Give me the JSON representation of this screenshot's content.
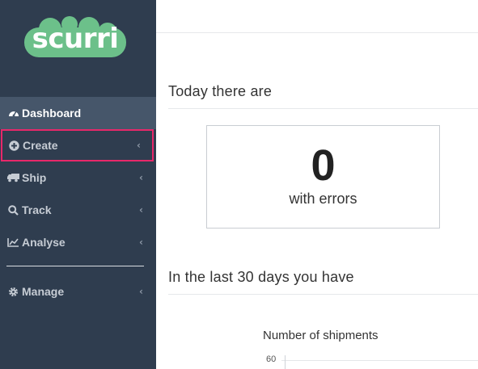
{
  "brand": {
    "name": "scurri",
    "cloud_color": "#6cc08a"
  },
  "sidebar": {
    "items": [
      {
        "label": "Dashboard",
        "icon": "dashboard-icon"
      },
      {
        "label": "Create",
        "icon": "plus-circle-icon"
      },
      {
        "label": "Ship",
        "icon": "truck-icon"
      },
      {
        "label": "Track",
        "icon": "search-icon"
      },
      {
        "label": "Analyse",
        "icon": "line-chart-icon"
      },
      {
        "label": "Manage",
        "icon": "gear-icon"
      }
    ],
    "chevron": "‹",
    "highlight_color": "#e8286a"
  },
  "main": {
    "today_heading": "Today there are",
    "errors": {
      "value": "0",
      "label": "with errors"
    },
    "period_heading": "In the last 30 days you have",
    "chart": {
      "title": "Number of shipments"
    }
  },
  "chart_data": {
    "type": "line",
    "title": "Number of shipments",
    "yticks": [
      60
    ]
  }
}
